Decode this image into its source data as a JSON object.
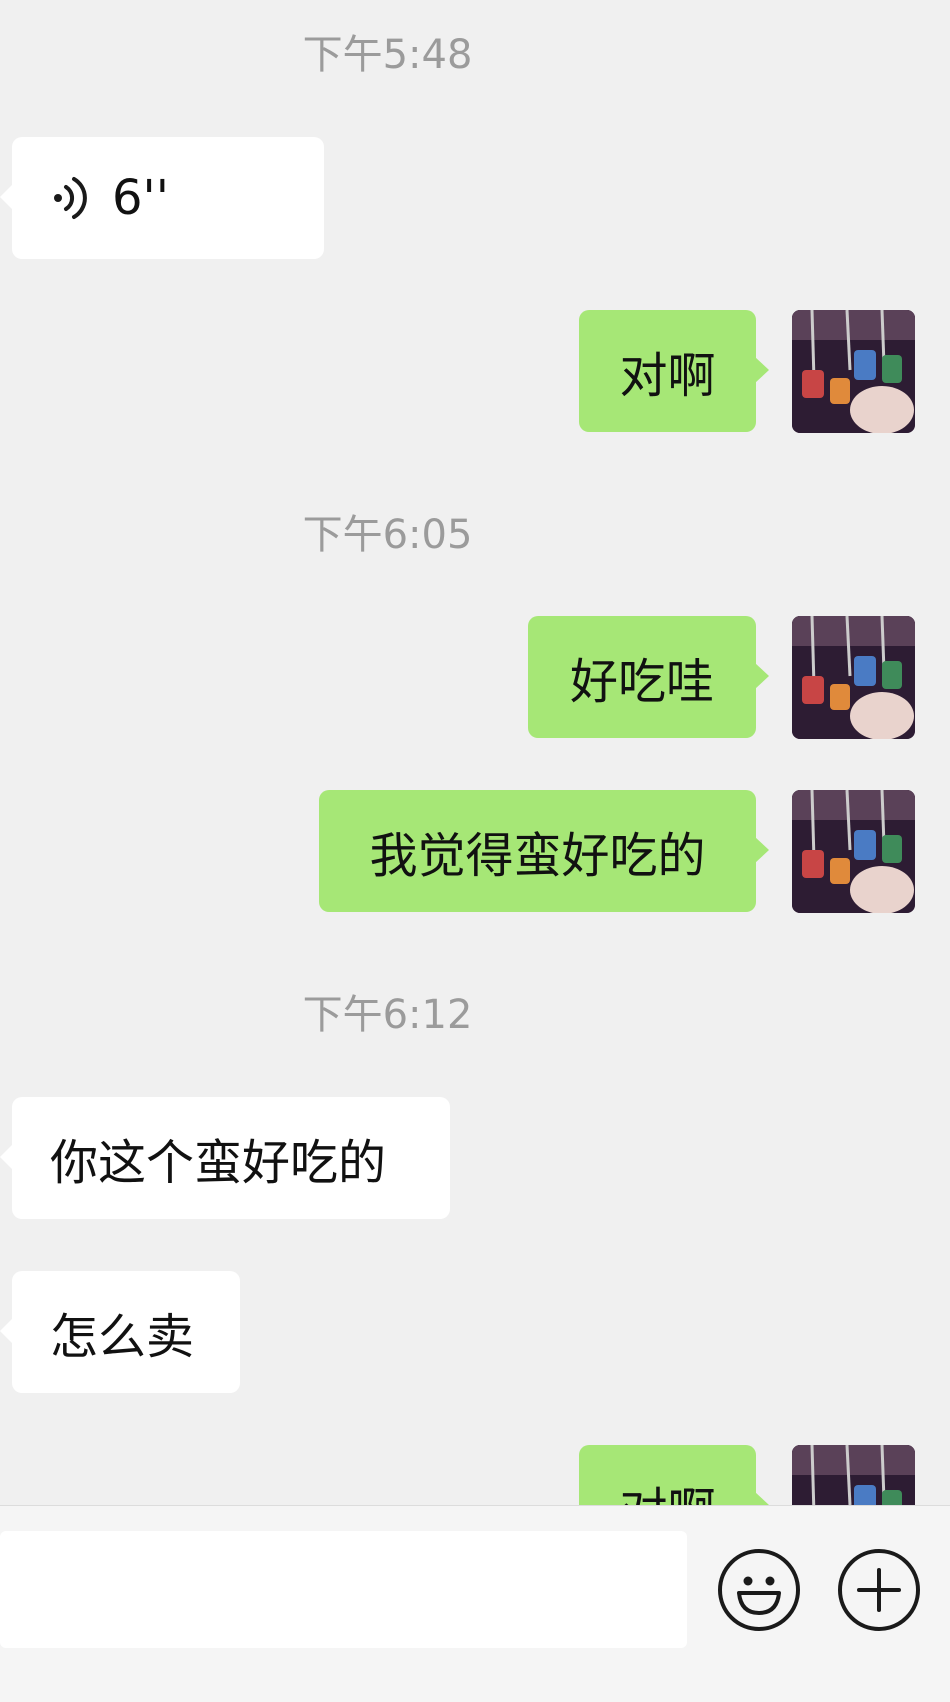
{
  "messages": {
    "t1": "下午5:48",
    "voice_duration": "6''",
    "m_out_1": "对啊",
    "t2": "下午6:05",
    "m_out_2": "好吃哇",
    "m_out_3": "我觉得蛮好吃的",
    "t3": "下午6:12",
    "m_in_1": "你这个蛮好吃的",
    "m_in_2": "怎么卖",
    "m_out_4": "对啊"
  },
  "icons": {
    "voice": "voice-wave-icon",
    "emoji": "emoji-smile-icon",
    "more": "plus-circle-icon"
  },
  "colors": {
    "outgoing_bubble": "#a6e776",
    "incoming_bubble": "#ffffff",
    "background": "#f0f0f0",
    "timestamp": "#9b9b9b"
  },
  "input": {
    "value": ""
  }
}
